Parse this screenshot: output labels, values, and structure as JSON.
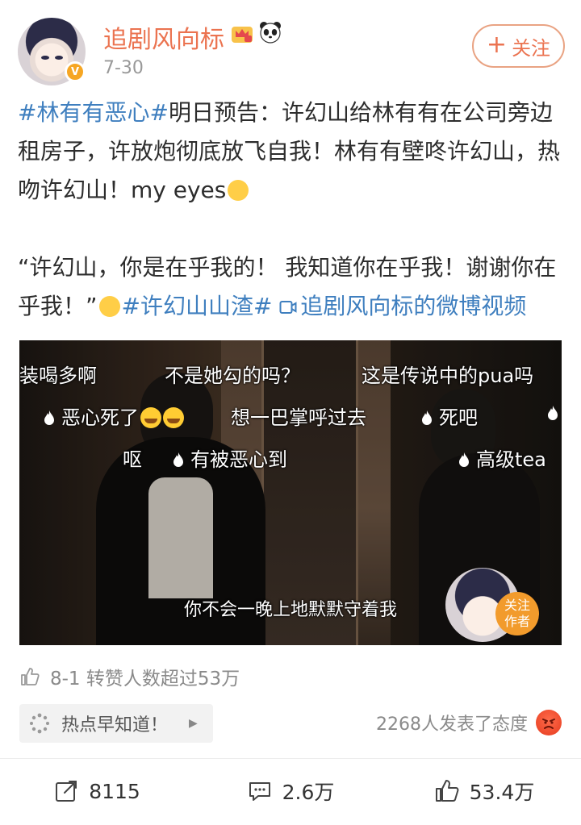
{
  "header": {
    "username": "追剧风向标",
    "date": "7-30",
    "follow_label": "关注",
    "follow_plus": "+",
    "verified_mark": "V"
  },
  "post": {
    "paragraph1": [
      {
        "text": "#林有有恶心#",
        "type": "hashtag"
      },
      {
        "text": "明日预告：许幻山给林有有在公司旁边租房子，许放炮彻底放飞自我！林有有壁咚许幻山，热吻许幻山！my eyes",
        "type": "text"
      }
    ],
    "paragraph2": [
      {
        "text": "“许幻山，你是在乎我的！ 我知道你在乎我！谢谢你在乎我！”",
        "type": "text"
      },
      {
        "text": "#许幻山山渣#",
        "type": "hashtag"
      },
      {
        "text": " ",
        "type": "text"
      },
      {
        "text": "追剧风向标的微博视频",
        "type": "link"
      }
    ]
  },
  "video": {
    "danmu": [
      {
        "text": "装喝多啊",
        "fire": false
      },
      {
        "text": "不是她勾的吗？",
        "fire": false
      },
      {
        "text": "这是传说中的pua吗",
        "fire": false
      },
      {
        "text": "恶心死了",
        "fire": true,
        "laugh": 2
      },
      {
        "text": "想一巴掌呼过去",
        "fire": false
      },
      {
        "text": "死吧",
        "fire": true
      },
      {
        "text": "",
        "fire": true
      },
      {
        "text": "呕",
        "fire": false
      },
      {
        "text": "有被恶心到",
        "fire": true
      },
      {
        "text": "高级tea",
        "fire": true
      }
    ],
    "subtitle": "你不会一晚上地默默守着我",
    "follow_author_line1": "关注",
    "follow_author_line2": "作者"
  },
  "forward_note": "8-1 转赞人数超过53万",
  "hot_tag": "热点早知道！",
  "reactions_text": "2268人发表了态度",
  "actions": {
    "repost_count": "8115",
    "comment_count": "2.6万",
    "like_count": "53.4万"
  },
  "colors": {
    "username": "#eb7350",
    "hashtag": "#3f7fbf",
    "follow_border": "#e9a383"
  }
}
